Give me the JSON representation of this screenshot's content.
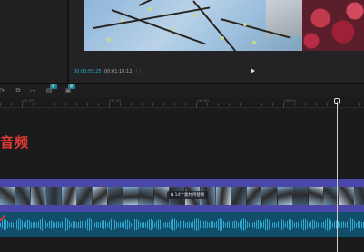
{
  "player": {
    "current_time": "00:00:55:25",
    "total_time": "00:01:18:12",
    "bracket": "[ ]"
  },
  "toolbar": {
    "icons": [
      "rotate-icon",
      "crop-icon",
      "screen-icon",
      "freeze-icon",
      "more-icon"
    ],
    "badge_1": "新",
    "badge_2": "新"
  },
  "ruler": {
    "labels": [
      "|00:20",
      "|00:30",
      "|00:40",
      "|00:50"
    ]
  },
  "timeline": {
    "overlay_text": "音频"
  },
  "video_track": {
    "clip_label": "⧉ 14个素材待替换"
  },
  "colors": {
    "accent_timecode": "#27b6c4",
    "video_track": "#4a47a8",
    "audio_track": "#114e6a",
    "overlay_text": "#e53935"
  }
}
